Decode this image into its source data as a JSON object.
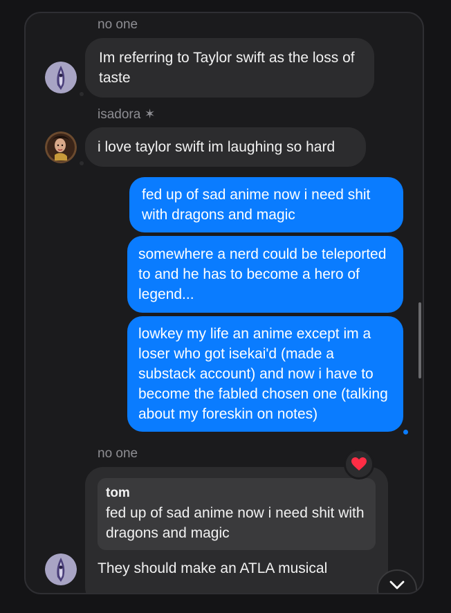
{
  "messages": [
    {
      "sender": "no one",
      "text": "Im referring to Taylor swift as the loss of taste"
    },
    {
      "sender": "isadora ✶",
      "text": "i love taylor swift im laughing so hard"
    },
    {
      "text": "fed up of sad anime now i need shit with dragons and magic"
    },
    {
      "text": "somewhere a nerd could be teleported to and he has to become a hero of legend..."
    },
    {
      "text": "lowkey my life an anime except im a loser who got isekai'd (made a substack account) and now i have to become the fabled chosen one (talking about my foreskin on notes)"
    },
    {
      "sender": "no one",
      "reply_to": {
        "name": "tom",
        "text": "fed up of sad anime now i need shit with dragons and magic"
      },
      "text": "They should make an ATLA musical",
      "reaction": "❤"
    }
  ],
  "colors": {
    "outgoing": "#0a7cff",
    "incoming": "#2c2c2e",
    "reaction": "#ff2d45"
  },
  "icons": {
    "scroll_down": "chevron-down-icon"
  }
}
